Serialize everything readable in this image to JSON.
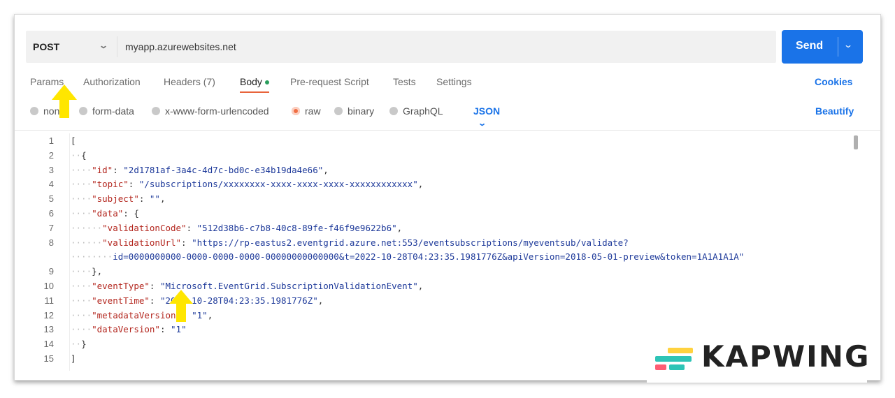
{
  "request": {
    "method": "POST",
    "url": "myapp.azurewebsites.net",
    "send_label": "Send"
  },
  "tabs": [
    {
      "label": "Params"
    },
    {
      "label": "Authorization"
    },
    {
      "label": "Headers (7)"
    },
    {
      "label": "Body",
      "active": true
    },
    {
      "label": "Pre-request Script"
    },
    {
      "label": "Tests"
    },
    {
      "label": "Settings"
    }
  ],
  "cookies_label": "Cookies",
  "body_options": [
    {
      "label": "none"
    },
    {
      "label": "form-data"
    },
    {
      "label": "x-www-form-urlencoded"
    },
    {
      "label": "raw",
      "selected": true
    },
    {
      "label": "binary"
    },
    {
      "label": "GraphQL"
    }
  ],
  "body_format": "JSON",
  "beautify_label": "Beautify",
  "editor": {
    "line_numbers": [
      "1",
      "2",
      "3",
      "4",
      "5",
      "6",
      "7",
      "8",
      "",
      "9",
      "10",
      "11",
      "12",
      "13",
      "14",
      "15"
    ],
    "lines": [
      "[",
      "  {",
      "    \"id\": \"2d1781af-3a4c-4d7c-bd0c-e34b19da4e66\",",
      "    \"topic\": \"/subscriptions/xxxxxxxx-xxxx-xxxx-xxxx-xxxxxxxxxxxx\",",
      "    \"subject\": \"\",",
      "    \"data\": {",
      "      \"validationCode\": \"512d38b6-c7b8-40c8-89fe-f46f9e9622b6\",",
      "      \"validationUrl\": \"https://rp-eastus2.eventgrid.azure.net:553/eventsubscriptions/myeventsub/validate?",
      "        id=0000000000-0000-0000-0000-00000000000000&t=2022-10-28T04:23:35.1981776Z&apiVersion=2018-05-01-preview&token=1A1A1A1A\"",
      "    },",
      "    \"eventType\": \"Microsoft.EventGrid.SubscriptionValidationEvent\",",
      "    \"eventTime\": \"2022-10-28T04:23:35.1981776Z\",",
      "    \"metadataVersion\": \"1\",",
      "    \"dataVersion\": \"1\"",
      "  }",
      "]"
    ]
  },
  "watermark": "KAPWING",
  "colors": {
    "send": "#1a73e8",
    "link": "#1a73e8",
    "active_underline": "#e8643b",
    "raw_radio": "#f06e44",
    "annotation_arrow": "#ffe600"
  }
}
